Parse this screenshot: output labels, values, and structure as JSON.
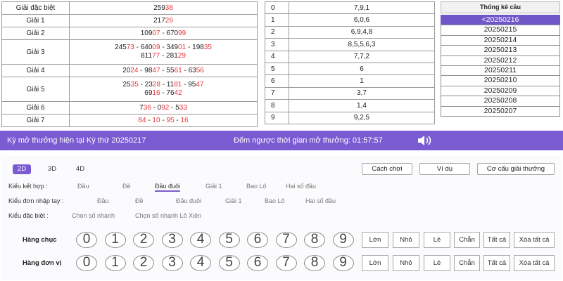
{
  "results": [
    {
      "label": "Giải đặc biệt",
      "lines": [
        [
          {
            "t": "259"
          },
          {
            "t": "38",
            "red": true
          }
        ]
      ]
    },
    {
      "label": "Giải 1",
      "lines": [
        [
          {
            "t": "217"
          },
          {
            "t": "26",
            "red": true
          }
        ]
      ]
    },
    {
      "label": "Giải 2",
      "lines": [
        [
          {
            "t": "109"
          },
          {
            "t": "07",
            "red": true
          },
          {
            "t": " - 670"
          },
          {
            "t": "99",
            "red": true
          }
        ]
      ]
    },
    {
      "label": "Giải 3",
      "lines": [
        [
          {
            "t": "245"
          },
          {
            "t": "73",
            "red": true
          },
          {
            "t": " - 640"
          },
          {
            "t": "09",
            "red": true
          },
          {
            "t": " - 349"
          },
          {
            "t": "01",
            "red": true
          },
          {
            "t": " - 198"
          },
          {
            "t": "35",
            "red": true
          }
        ],
        [
          {
            "t": "811"
          },
          {
            "t": "77",
            "red": true
          },
          {
            "t": " - 281"
          },
          {
            "t": "29",
            "red": true
          }
        ]
      ]
    },
    {
      "label": "Giải 4",
      "lines": [
        [
          {
            "t": "20"
          },
          {
            "t": "24",
            "red": true
          },
          {
            "t": " - 98"
          },
          {
            "t": "47",
            "red": true
          },
          {
            "t": " - 55"
          },
          {
            "t": "61",
            "red": true
          },
          {
            "t": " - 63"
          },
          {
            "t": "56",
            "red": true
          }
        ]
      ]
    },
    {
      "label": "Giải 5",
      "lines": [
        [
          {
            "t": "25"
          },
          {
            "t": "35",
            "red": true
          },
          {
            "t": " - 23"
          },
          {
            "t": "28",
            "red": true
          },
          {
            "t": " - 11"
          },
          {
            "t": "81",
            "red": true
          },
          {
            "t": " - 95"
          },
          {
            "t": "47",
            "red": true
          }
        ],
        [
          {
            "t": "69"
          },
          {
            "t": "16",
            "red": true
          },
          {
            "t": " - 76"
          },
          {
            "t": "42",
            "red": true
          }
        ]
      ]
    },
    {
      "label": "Giải 6",
      "lines": [
        [
          {
            "t": "7"
          },
          {
            "t": "36",
            "red": true
          },
          {
            "t": " - 0"
          },
          {
            "t": "92",
            "red": true
          },
          {
            "t": " - 5"
          },
          {
            "t": "33",
            "red": true
          }
        ]
      ]
    },
    {
      "label": "Giải 7",
      "lines": [
        [
          {
            "t": "84",
            "red": true
          },
          {
            "t": " - "
          },
          {
            "t": "10",
            "red": true
          },
          {
            "t": " - "
          },
          {
            "t": "95",
            "red": true
          },
          {
            "t": " - "
          },
          {
            "t": "16",
            "red": true
          }
        ]
      ]
    }
  ],
  "head_tail": [
    {
      "head": "0",
      "tails": "7,9,1"
    },
    {
      "head": "1",
      "tails": "6,0,6"
    },
    {
      "head": "2",
      "tails": "6,9,4,8"
    },
    {
      "head": "3",
      "tails": "8,5,5,6,3"
    },
    {
      "head": "4",
      "tails": "7,7,2"
    },
    {
      "head": "5",
      "tails": "6"
    },
    {
      "head": "6",
      "tails": "1"
    },
    {
      "head": "7",
      "tails": "3,7"
    },
    {
      "head": "8",
      "tails": "1,4"
    },
    {
      "head": "9",
      "tails": "9,2,5"
    }
  ],
  "stats": {
    "title": "Thống kê cầu",
    "items": [
      "<20250216",
      "20250215",
      "20250214",
      "20250213",
      "20250212",
      "20250211",
      "20250210",
      "20250209",
      "20250208",
      "20250207"
    ],
    "active_index": 0
  },
  "banner": {
    "current_draw": "Kỳ mở thưởng hiện tại Kỳ thứ 20250217",
    "countdown": "Đếm ngược thời gian mở thưởng: 01:57:57",
    "accent_color": "#7b5bd1"
  },
  "game_tabs": {
    "items": [
      "2D",
      "3D",
      "4D"
    ],
    "active_index": 0
  },
  "top_buttons": {
    "how_to_play": "Cách chơi",
    "example": "Ví dụ",
    "prize_structure": "Cơ cấu giải thưởng"
  },
  "bet_types": {
    "combo": {
      "label": "Kiểu kết hợp :",
      "options": [
        "Đầu",
        "Đề",
        "Đầu đuôi",
        "Giải 1",
        "Bao Lô",
        "Hai số đầu"
      ],
      "active_index": 2
    },
    "manual": {
      "label": "Kiểu đơn nhập tay :",
      "options": [
        "Đầu",
        "Đề",
        "Đầu đuôi",
        "Giải 1",
        "Bao Lô",
        "Hai số đầu"
      ]
    },
    "special": {
      "label": "Kiểu đặc biệt :",
      "options": [
        "Chọn số nhanh",
        "Chọn số nhanh Lô Xiên"
      ]
    }
  },
  "positions": [
    {
      "label": "Hàng chục"
    },
    {
      "label": "Hàng đơn vị"
    }
  ],
  "digits": [
    "0",
    "1",
    "2",
    "3",
    "4",
    "5",
    "6",
    "7",
    "8",
    "9"
  ],
  "quick_select": [
    "Lớn",
    "Nhỏ",
    "Lẻ",
    "Chẵn",
    "Tất cả",
    "Xóa tất cả"
  ]
}
